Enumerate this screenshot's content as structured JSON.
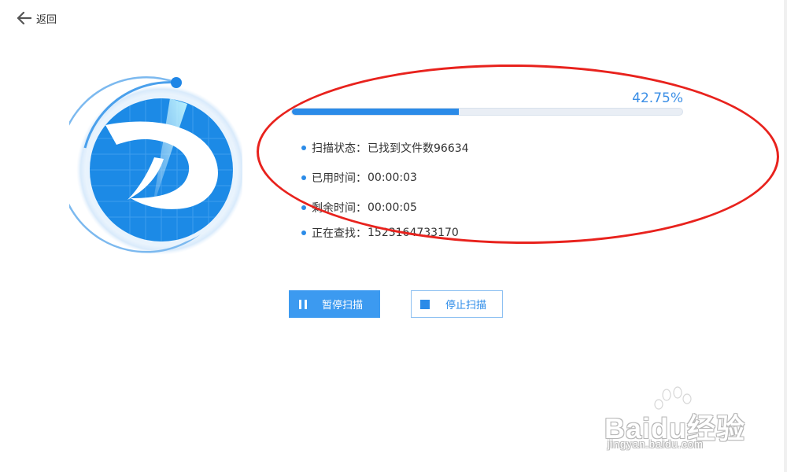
{
  "header": {
    "back_label": "返回"
  },
  "progress": {
    "percent_text": "42.75%",
    "fraction": 0.4275
  },
  "info": [
    {
      "label": "扫描状态：",
      "value": "已找到文件数96634"
    },
    {
      "label": "已用时间：",
      "value": "00:00:03"
    },
    {
      "label": "剩余时间：",
      "value": "00:00:05"
    },
    {
      "label": "正在查找：",
      "value": "1523164733170"
    }
  ],
  "buttons": {
    "pause_label": "暂停扫描",
    "stop_label": "停止扫描"
  },
  "watermark": {
    "line1": "Baidu经验",
    "line2": "jingyan.baidu.com"
  },
  "colors": {
    "accent": "#2b8be8",
    "annotation": "#e8221d"
  }
}
